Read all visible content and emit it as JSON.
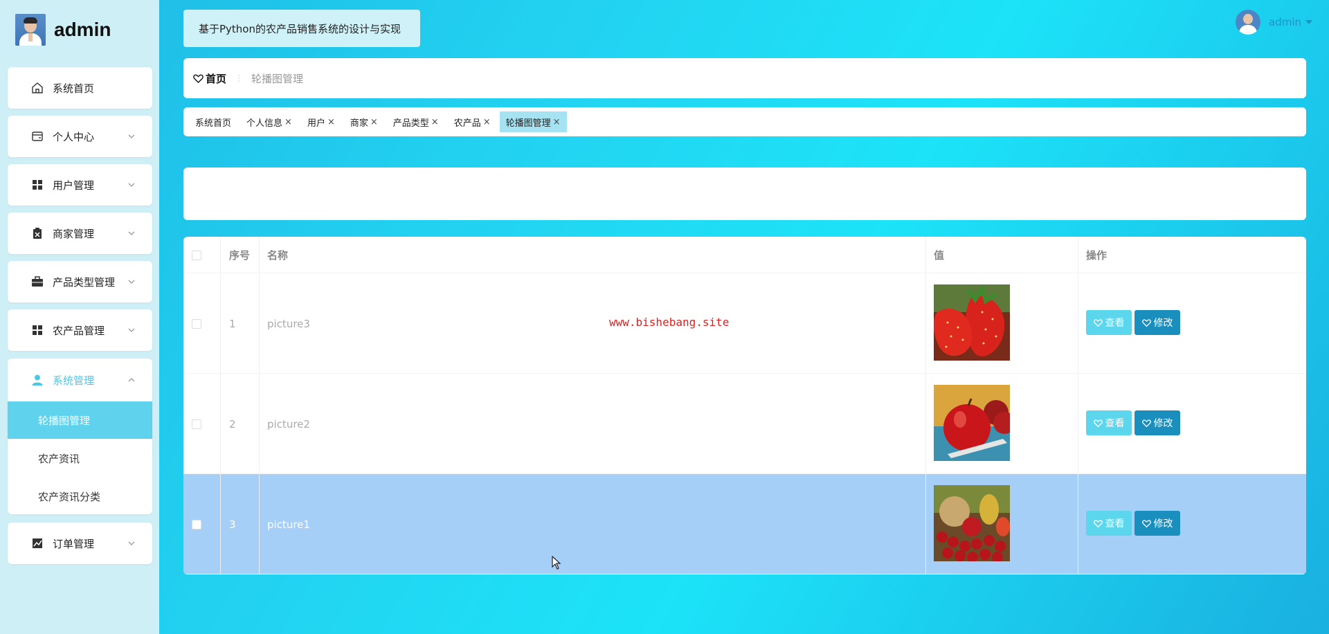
{
  "brand": {
    "name": "admin"
  },
  "system_title": "基于Python的农产品销售系统的设计与实现",
  "user": {
    "name": "admin"
  },
  "sidebar": {
    "items": [
      {
        "label": "系统首页",
        "icon": "home-icon"
      },
      {
        "label": "个人中心",
        "icon": "wallet-icon"
      },
      {
        "label": "用户管理",
        "icon": "grid-icon"
      },
      {
        "label": "商家管理",
        "icon": "clipboard-icon"
      },
      {
        "label": "产品类型管理",
        "icon": "briefcase-icon"
      },
      {
        "label": "农产品管理",
        "icon": "grid-icon"
      },
      {
        "label": "系统管理",
        "icon": "user-icon"
      },
      {
        "label": "订单管理",
        "icon": "chart-icon"
      }
    ],
    "submenu": [
      {
        "label": "轮播图管理"
      },
      {
        "label": "农产资讯"
      },
      {
        "label": "农产资讯分类"
      }
    ]
  },
  "breadcrumb": {
    "home": "首页",
    "current": "轮播图管理"
  },
  "tags": [
    {
      "label": "系统首页"
    },
    {
      "label": "个人信息"
    },
    {
      "label": "用户"
    },
    {
      "label": "商家"
    },
    {
      "label": "产品类型"
    },
    {
      "label": "农产品"
    },
    {
      "label": "轮播图管理"
    }
  ],
  "table": {
    "columns": [
      "序号",
      "名称",
      "值",
      "操作"
    ],
    "rows": [
      {
        "index": "1",
        "name": "picture3",
        "image": "strawberries"
      },
      {
        "index": "2",
        "name": "picture2",
        "image": "apples"
      },
      {
        "index": "3",
        "name": "picture1",
        "image": "fruit-mix"
      }
    ],
    "view_label": "查看",
    "edit_label": "修改"
  },
  "watermark": "www.bishebang.site",
  "colors": {
    "accent": "#1a8fbe",
    "accent_light": "#5cd6ec",
    "selected_row": "#a6cff8"
  }
}
